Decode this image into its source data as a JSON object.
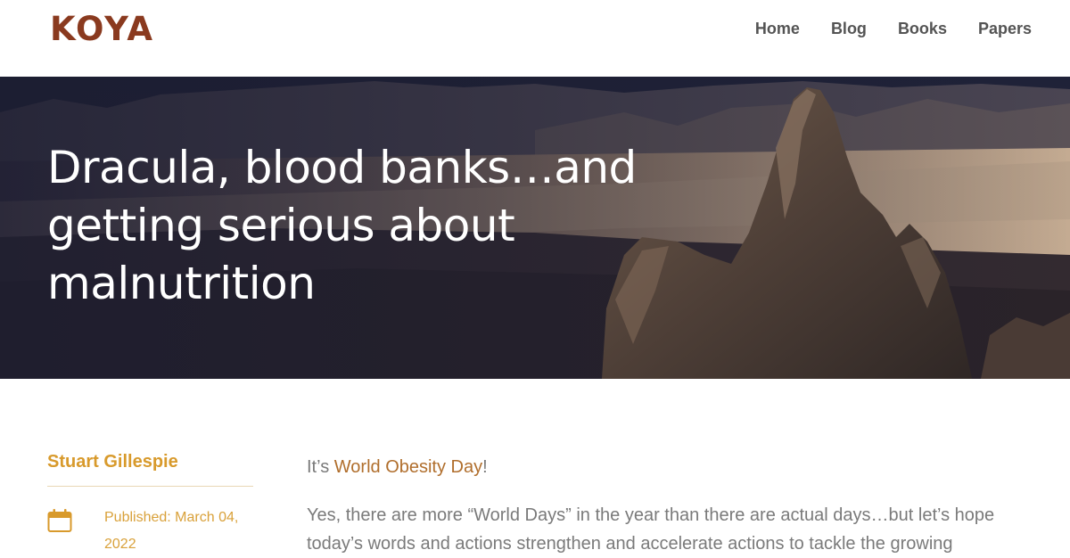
{
  "header": {
    "logo": "KOYA",
    "nav": [
      {
        "label": "Home"
      },
      {
        "label": "Blog"
      },
      {
        "label": "Books"
      },
      {
        "label": "Papers"
      }
    ]
  },
  "hero": {
    "title": "Dracula, blood banks…and getting serious about malnutrition"
  },
  "sidebar": {
    "author": "Stuart Gillespie",
    "published": "Published: March 04, 2022",
    "calendar_icon": "calendar-icon"
  },
  "content": {
    "intro_prefix": "It’s ",
    "intro_link": "World Obesity Day",
    "intro_suffix": "!",
    "paragraph": "Yes, there are more “World Days” in the year than there are actual days…but let’s hope today’s words and actions strengthen and accelerate actions to tackle the growing"
  },
  "colors": {
    "logo": "#8a3a1f",
    "nav": "#545454",
    "accent": "#d89a2c",
    "link": "#b06e2c",
    "body_text": "#7a7a7a"
  }
}
